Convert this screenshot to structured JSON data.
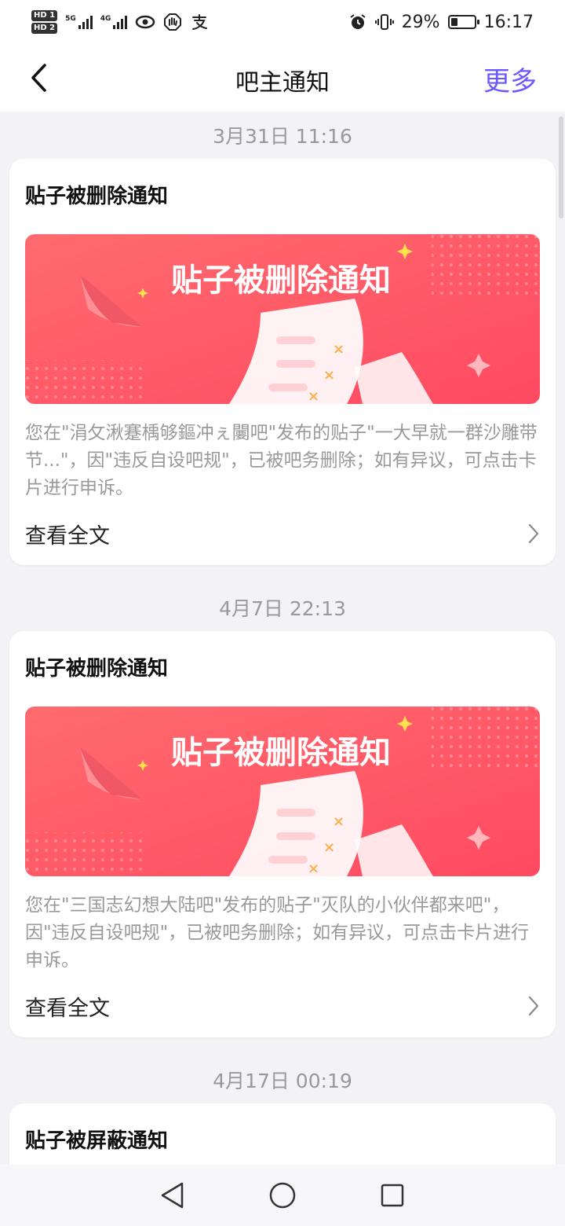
{
  "status_bar": {
    "hd1": "HD 1",
    "hd2": "HD 2",
    "net1": "5G",
    "net2": "4G",
    "battery_percent": "29%",
    "battery_level": 0.29,
    "time": "16:17",
    "icons": [
      "eye-icon",
      "hand-icon",
      "alipay-icon",
      "alarm-icon",
      "vibrate-icon",
      "battery-icon"
    ]
  },
  "header": {
    "title": "吧主通知",
    "more_label": "更多"
  },
  "notifications": [
    {
      "timestamp": "3月31日 11:16",
      "title": "贴子被删除通知",
      "banner_text": "贴子被删除通知",
      "description": "您在\"涓攵湫蹇楀够鏂冲ぇ闄吧\"发布的贴子\"一大早就一群沙雕带节...\"，因\"违反自设吧规\"，已被吧务删除；如有异议，可点击卡片进行申诉。",
      "view_label": "查看全文"
    },
    {
      "timestamp": "4月7日 22:13",
      "title": "贴子被删除通知",
      "banner_text": "贴子被删除通知",
      "description": "您在\"三国志幻想大陆吧\"发布的贴子\"灭队的小伙伴都来吧\"，因\"违反自设吧规\"，已被吧务删除；如有异议，可点击卡片进行申诉。",
      "view_label": "查看全文"
    },
    {
      "timestamp": "4月17日 00:19",
      "title": "贴子被屏蔽通知"
    }
  ],
  "colors": {
    "accent": "#6b57ff",
    "banner_red": "#ff5a68",
    "background": "#f3f3f5"
  }
}
